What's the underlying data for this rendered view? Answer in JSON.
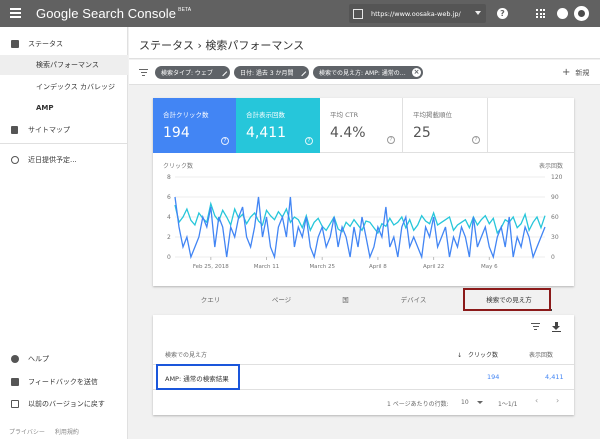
{
  "topbar": {
    "brand": "Google Search Console",
    "beta": "BETA",
    "property_url": "https://www.oosaka-web.jp/",
    "help_symbol": "?"
  },
  "sidebar": {
    "items": [
      {
        "label": "ステータス",
        "icon": "dashboard-icon"
      },
      {
        "label": "検索パフォーマンス"
      },
      {
        "label": "インデックス カバレッジ"
      },
      {
        "label": "AMP"
      },
      {
        "label": "サイトマップ",
        "icon": "upload-icon"
      },
      {
        "label": "近日提供予定...",
        "icon": "info-icon"
      }
    ],
    "bottom": [
      {
        "label": "ヘルプ",
        "icon": "help-icon"
      },
      {
        "label": "フィードバックを送信",
        "icon": "feedback-icon"
      },
      {
        "label": "以前のバージョンに戻す",
        "icon": "exit-icon"
      }
    ],
    "footer": [
      "プライバシー",
      "利用規約"
    ]
  },
  "header": {
    "title": "ステータス › 検索パフォーマンス"
  },
  "filters": {
    "chips": [
      "検索タイプ: ウェブ",
      "日付: 過去 3 か月間",
      "検索での見え方: AMP: 通常の…"
    ],
    "new_label": "新規"
  },
  "metrics": [
    {
      "label": "合計クリック数",
      "value": "194",
      "help": "?"
    },
    {
      "label": "合計表示回数",
      "value": "4,411",
      "help": "?"
    },
    {
      "label": "平均 CTR",
      "value": "4.4%",
      "help": "?"
    },
    {
      "label": "平均掲載順位",
      "value": "25",
      "help": "?"
    }
  ],
  "colors": {
    "clicks": "#4285f4",
    "impressions": "#26c6da",
    "highlight_red": "#8b1a1a",
    "highlight_blue": "#1a56db"
  },
  "chart_data": {
    "type": "line",
    "y_left_label": "クリック数",
    "y_right_label": "表示回数",
    "y_left_ticks": [
      "8",
      "6",
      "4",
      "2",
      "0"
    ],
    "y_right_ticks": [
      "120",
      "90",
      "60",
      "30",
      "0"
    ],
    "ylim_left": [
      0,
      8
    ],
    "ylim_right": [
      0,
      120
    ],
    "x_tick_labels": [
      "Feb 25, 2018",
      "March 11",
      "March 25",
      "April 8",
      "April 22",
      "May 6"
    ],
    "x_tick_index": [
      9,
      23,
      37,
      51,
      65,
      79
    ],
    "grid": true,
    "series": [
      {
        "name": "クリック数",
        "axis": "left",
        "values": [
          6,
          3,
          1,
          2,
          0,
          1,
          2,
          4,
          3,
          5,
          1,
          4,
          3,
          0,
          3,
          2,
          4,
          5,
          2,
          1,
          3,
          6,
          2,
          4,
          1,
          0,
          3,
          4,
          2,
          6,
          1,
          3,
          2,
          4,
          1,
          0,
          2,
          3,
          1,
          2,
          4,
          1,
          3,
          2,
          0,
          3,
          1,
          4,
          2,
          0,
          1,
          3,
          2,
          5,
          1,
          2,
          0,
          3,
          4,
          1,
          2,
          1,
          0,
          3,
          2,
          4,
          1,
          2,
          3,
          0,
          2,
          1,
          3,
          2,
          0,
          4,
          1,
          2,
          3,
          1,
          0,
          2,
          3,
          1,
          4,
          0,
          2,
          1,
          3,
          2,
          0,
          1,
          2,
          3
        ]
      },
      {
        "name": "表示回数",
        "axis": "right",
        "values": [
          78,
          52,
          60,
          72,
          55,
          48,
          66,
          58,
          52,
          80,
          62,
          54,
          70,
          60,
          48,
          72,
          58,
          64,
          50,
          60,
          66,
          54,
          48,
          70,
          62,
          56,
          68,
          60,
          72,
          52,
          60,
          56,
          44,
          62,
          40,
          52,
          58,
          46,
          40,
          50,
          60,
          42,
          38,
          52,
          46,
          56,
          48,
          40,
          54,
          52,
          44,
          36,
          50,
          46,
          58,
          48,
          52,
          60,
          44,
          56,
          40,
          48,
          62,
          54,
          50,
          66,
          48,
          52,
          56,
          60,
          40,
          48,
          52,
          56,
          44,
          60,
          48,
          56,
          62,
          50,
          58,
          36,
          44,
          56,
          52,
          60,
          44,
          50,
          64,
          40,
          52,
          60,
          44,
          62
        ]
      }
    ]
  },
  "tabs": {
    "items": [
      "クエリ",
      "ページ",
      "国",
      "デバイス",
      "検索での見え方"
    ],
    "active": 4
  },
  "table": {
    "headers": [
      "検索での見え方",
      "クリック数",
      "表示回数"
    ],
    "sort_arrow": "↓",
    "rows": [
      {
        "name": "AMP: 通常の検索結果",
        "clicks": "194",
        "impressions": "4,411"
      }
    ],
    "pagination": {
      "rows_per_page_label": "1 ページあたりの行数:",
      "rows_per_page": "10",
      "range": "1〜1/1"
    }
  }
}
